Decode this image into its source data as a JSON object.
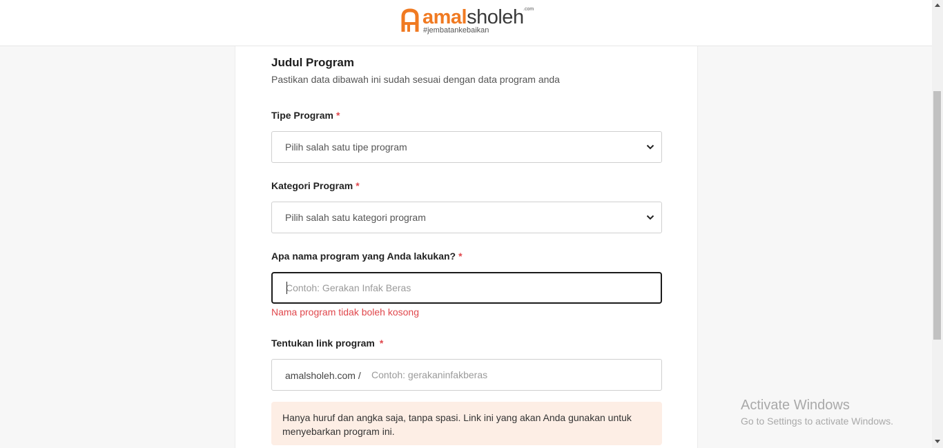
{
  "header": {
    "logo_amal": "amal",
    "logo_sholeh": "sholeh",
    "logo_com": ".com",
    "logo_tagline": "#jembatankebaikan",
    "brand_color": "#f07a22"
  },
  "form": {
    "title": "Judul Program",
    "subtitle": "Pastikan data dibawah ini sudah sesuai dengan data program anda",
    "required_mark": "*",
    "tipe_program": {
      "label": "Tipe Program",
      "value": "Pilih salah satu tipe program"
    },
    "kategori_program": {
      "label": "Kategori Program",
      "value": "Pilih salah satu kategori program"
    },
    "nama_program": {
      "label": "Apa nama program yang Anda lakukan?",
      "placeholder": "Contoh: Gerakan Infak Beras",
      "error": "Nama program tidak boleh kosong"
    },
    "link_program": {
      "label": "Tentukan link program",
      "prefix": "amalsholeh.com /",
      "placeholder": "Contoh: gerakaninfakberas",
      "note": "Hanya huruf dan angka saja, tanpa spasi. Link ini yang akan Anda gunakan untuk menyebarkan program ini."
    },
    "error_color": "#e0474c"
  },
  "watermark": {
    "line1": "Activate Windows",
    "line2": "Go to Settings to activate Windows."
  }
}
